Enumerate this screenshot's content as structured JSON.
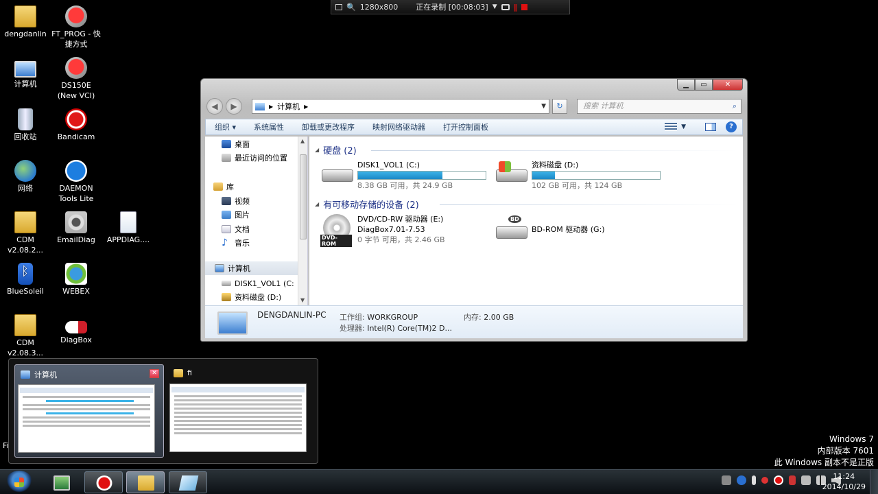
{
  "recorder": {
    "resolution": "1280x800",
    "status": "正在录制 [00:08:03]"
  },
  "desktop_icons": [
    {
      "label": "dengdanlin",
      "icon": "user-folder-icon"
    },
    {
      "label": "FT_PROG - 快捷方式",
      "icon": "usb-icon"
    },
    {
      "label": "计算机",
      "icon": "computer-icon"
    },
    {
      "label": "DS150E (New VCI)",
      "icon": "ds150e-icon"
    },
    {
      "label": "回收站",
      "icon": "recycle-bin-icon"
    },
    {
      "label": "Bandicam",
      "icon": "bandicam-icon"
    },
    {
      "label": "网络",
      "icon": "network-icon"
    },
    {
      "label": "DAEMON Tools Lite",
      "icon": "daemon-tools-icon"
    },
    {
      "label": "CDM v2.08.2...",
      "icon": "cdm-folder-icon"
    },
    {
      "label": "EmailDiag",
      "icon": "emaildiag-icon"
    },
    {
      "label": "APPDIAG....",
      "icon": "appdiag-icon"
    },
    {
      "label": "BlueSoleil",
      "icon": "bluetooth-icon"
    },
    {
      "label": "WEBEX",
      "icon": "webex-icon"
    },
    {
      "label": "CDM v2.08.3...",
      "icon": "cdm-folder-icon"
    },
    {
      "label": "DiagBox",
      "icon": "diagbox-icon"
    }
  ],
  "explorer": {
    "breadcrumb": "计算机",
    "search_placeholder": "搜索 计算机",
    "toolbar": {
      "organize": "组织 ▾",
      "system_properties": "系统属性",
      "uninstall": "卸载或更改程序",
      "map_drive": "映射网络驱动器",
      "control_panel": "打开控制面板"
    },
    "nav": {
      "desktop": "桌面",
      "recent": "最近访问的位置",
      "libraries": "库",
      "videos": "视频",
      "pictures": "图片",
      "documents": "文档",
      "music": "音乐",
      "computer": "计算机",
      "disk_c": "DISK1_VOL1 (C:",
      "disk_d": "资料磁盘 (D:)"
    },
    "groups": {
      "hard_disks": "硬盘 (2)",
      "removable": "有可移动存储的设备 (2)"
    },
    "drives": {
      "c": {
        "name": "DISK1_VOL1 (C:)",
        "space": "8.38 GB 可用，共 24.9 GB",
        "used_fraction": 0.66
      },
      "d": {
        "name": "资料磁盘 (D:)",
        "space": "102 GB 可用，共 124 GB",
        "used_fraction": 0.18
      },
      "e": {
        "name": "DVD/CD-RW 驱动器 (E:)",
        "label": "DiagBox7.01-7.53",
        "space": "0 字节 可用，共 2.46 GB",
        "badge": "DVD-ROM"
      },
      "g": {
        "name": "BD-ROM 驱动器 (G:)",
        "badge": "BD"
      }
    },
    "details": {
      "pc_name": "DENGDANLIN-PC",
      "workgroup_label": "工作组:",
      "workgroup": "WORKGROUP",
      "memory_label": "内存:",
      "memory": "2.00 GB",
      "cpu_label": "处理器:",
      "cpu": "Intel(R) Core(TM)2 D..."
    }
  },
  "switcher": {
    "items": [
      {
        "title": "计算机"
      },
      {
        "title": "fi"
      }
    ]
  },
  "fi_label": "Fi",
  "watermark": {
    "line1": "Windows 7",
    "line2": "内部版本 7601",
    "line3": "此 Windows 副本不是正版"
  },
  "clock": {
    "time": "11:24",
    "date": "2014/10/29"
  },
  "colors": {
    "accent_blue": "#1e3287",
    "disk_bar": "#1b88c6",
    "record_red": "#e01010"
  }
}
